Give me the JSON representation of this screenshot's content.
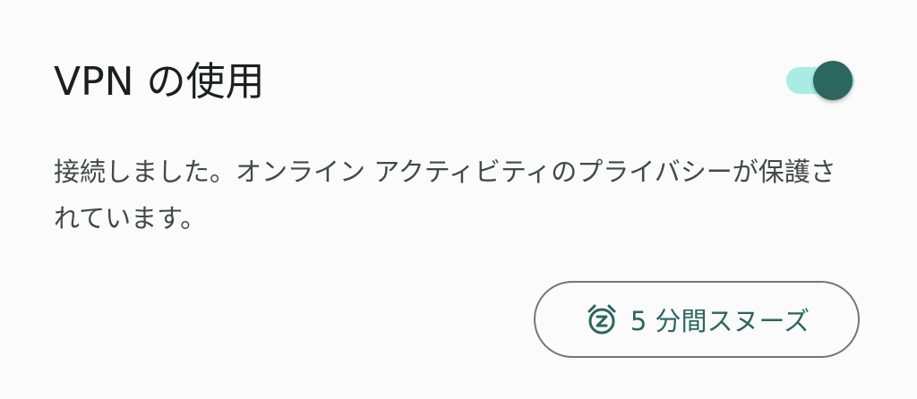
{
  "card": {
    "title": "VPN の使用",
    "toggle": {
      "state": "on",
      "track_color": "#a9ece6",
      "thumb_color": "#2b6661"
    },
    "description": "接続しました。オンライン アクティビティのプライバシーが保護されています。",
    "snooze_button": {
      "icon": "snooze-alarm-icon",
      "label": "5 分間スヌーズ",
      "accent_color": "#2b6661"
    }
  }
}
